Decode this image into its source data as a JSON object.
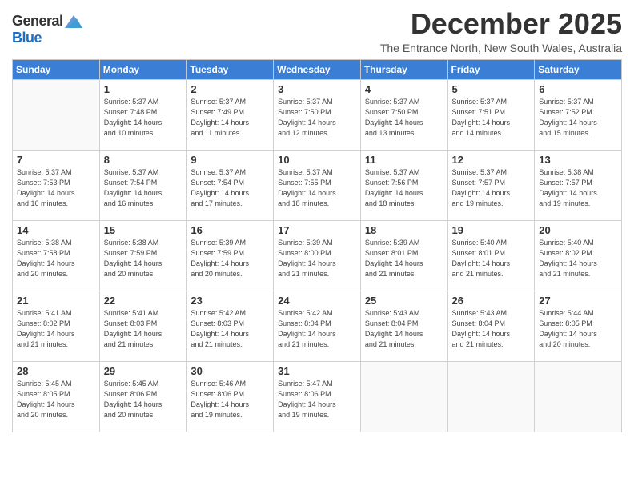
{
  "logo": {
    "general": "General",
    "blue": "Blue"
  },
  "title": "December 2025",
  "subtitle": "The Entrance North, New South Wales, Australia",
  "headers": [
    "Sunday",
    "Monday",
    "Tuesday",
    "Wednesday",
    "Thursday",
    "Friday",
    "Saturday"
  ],
  "weeks": [
    [
      {
        "day": "",
        "info": ""
      },
      {
        "day": "1",
        "info": "Sunrise: 5:37 AM\nSunset: 7:48 PM\nDaylight: 14 hours\nand 10 minutes."
      },
      {
        "day": "2",
        "info": "Sunrise: 5:37 AM\nSunset: 7:49 PM\nDaylight: 14 hours\nand 11 minutes."
      },
      {
        "day": "3",
        "info": "Sunrise: 5:37 AM\nSunset: 7:50 PM\nDaylight: 14 hours\nand 12 minutes."
      },
      {
        "day": "4",
        "info": "Sunrise: 5:37 AM\nSunset: 7:50 PM\nDaylight: 14 hours\nand 13 minutes."
      },
      {
        "day": "5",
        "info": "Sunrise: 5:37 AM\nSunset: 7:51 PM\nDaylight: 14 hours\nand 14 minutes."
      },
      {
        "day": "6",
        "info": "Sunrise: 5:37 AM\nSunset: 7:52 PM\nDaylight: 14 hours\nand 15 minutes."
      }
    ],
    [
      {
        "day": "7",
        "info": "Sunrise: 5:37 AM\nSunset: 7:53 PM\nDaylight: 14 hours\nand 16 minutes."
      },
      {
        "day": "8",
        "info": "Sunrise: 5:37 AM\nSunset: 7:54 PM\nDaylight: 14 hours\nand 16 minutes."
      },
      {
        "day": "9",
        "info": "Sunrise: 5:37 AM\nSunset: 7:54 PM\nDaylight: 14 hours\nand 17 minutes."
      },
      {
        "day": "10",
        "info": "Sunrise: 5:37 AM\nSunset: 7:55 PM\nDaylight: 14 hours\nand 18 minutes."
      },
      {
        "day": "11",
        "info": "Sunrise: 5:37 AM\nSunset: 7:56 PM\nDaylight: 14 hours\nand 18 minutes."
      },
      {
        "day": "12",
        "info": "Sunrise: 5:37 AM\nSunset: 7:57 PM\nDaylight: 14 hours\nand 19 minutes."
      },
      {
        "day": "13",
        "info": "Sunrise: 5:38 AM\nSunset: 7:57 PM\nDaylight: 14 hours\nand 19 minutes."
      }
    ],
    [
      {
        "day": "14",
        "info": "Sunrise: 5:38 AM\nSunset: 7:58 PM\nDaylight: 14 hours\nand 20 minutes."
      },
      {
        "day": "15",
        "info": "Sunrise: 5:38 AM\nSunset: 7:59 PM\nDaylight: 14 hours\nand 20 minutes."
      },
      {
        "day": "16",
        "info": "Sunrise: 5:39 AM\nSunset: 7:59 PM\nDaylight: 14 hours\nand 20 minutes."
      },
      {
        "day": "17",
        "info": "Sunrise: 5:39 AM\nSunset: 8:00 PM\nDaylight: 14 hours\nand 21 minutes."
      },
      {
        "day": "18",
        "info": "Sunrise: 5:39 AM\nSunset: 8:01 PM\nDaylight: 14 hours\nand 21 minutes."
      },
      {
        "day": "19",
        "info": "Sunrise: 5:40 AM\nSunset: 8:01 PM\nDaylight: 14 hours\nand 21 minutes."
      },
      {
        "day": "20",
        "info": "Sunrise: 5:40 AM\nSunset: 8:02 PM\nDaylight: 14 hours\nand 21 minutes."
      }
    ],
    [
      {
        "day": "21",
        "info": "Sunrise: 5:41 AM\nSunset: 8:02 PM\nDaylight: 14 hours\nand 21 minutes."
      },
      {
        "day": "22",
        "info": "Sunrise: 5:41 AM\nSunset: 8:03 PM\nDaylight: 14 hours\nand 21 minutes."
      },
      {
        "day": "23",
        "info": "Sunrise: 5:42 AM\nSunset: 8:03 PM\nDaylight: 14 hours\nand 21 minutes."
      },
      {
        "day": "24",
        "info": "Sunrise: 5:42 AM\nSunset: 8:04 PM\nDaylight: 14 hours\nand 21 minutes."
      },
      {
        "day": "25",
        "info": "Sunrise: 5:43 AM\nSunset: 8:04 PM\nDaylight: 14 hours\nand 21 minutes."
      },
      {
        "day": "26",
        "info": "Sunrise: 5:43 AM\nSunset: 8:04 PM\nDaylight: 14 hours\nand 21 minutes."
      },
      {
        "day": "27",
        "info": "Sunrise: 5:44 AM\nSunset: 8:05 PM\nDaylight: 14 hours\nand 20 minutes."
      }
    ],
    [
      {
        "day": "28",
        "info": "Sunrise: 5:45 AM\nSunset: 8:05 PM\nDaylight: 14 hours\nand 20 minutes."
      },
      {
        "day": "29",
        "info": "Sunrise: 5:45 AM\nSunset: 8:06 PM\nDaylight: 14 hours\nand 20 minutes."
      },
      {
        "day": "30",
        "info": "Sunrise: 5:46 AM\nSunset: 8:06 PM\nDaylight: 14 hours\nand 19 minutes."
      },
      {
        "day": "31",
        "info": "Sunrise: 5:47 AM\nSunset: 8:06 PM\nDaylight: 14 hours\nand 19 minutes."
      },
      {
        "day": "",
        "info": ""
      },
      {
        "day": "",
        "info": ""
      },
      {
        "day": "",
        "info": ""
      }
    ]
  ]
}
